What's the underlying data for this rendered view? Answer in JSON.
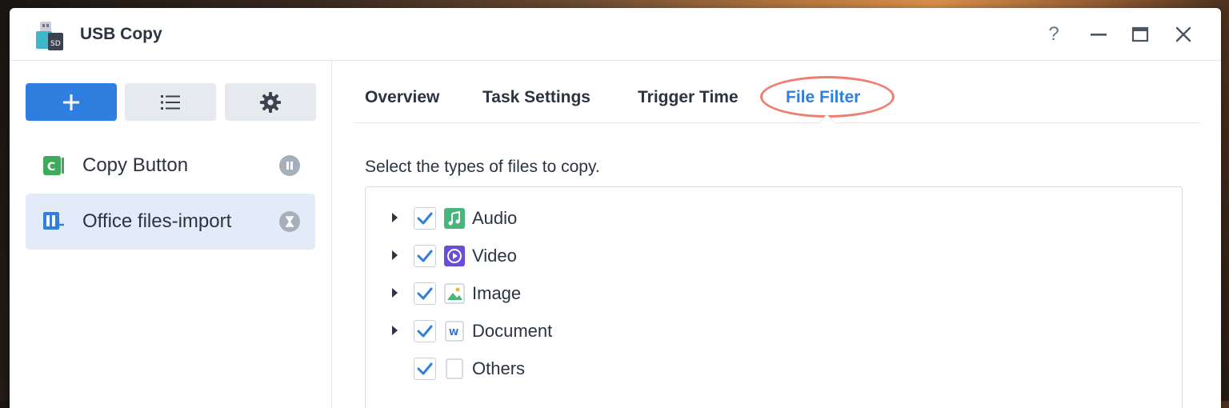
{
  "window": {
    "title": "USB Copy",
    "app_icon": "usb-sd-icon"
  },
  "title_controls": {
    "help": "?",
    "icons": [
      "help-icon",
      "minimize-icon",
      "maximize-icon",
      "close-icon"
    ]
  },
  "toolbar": {
    "icons": [
      "plus-icon",
      "list-icon",
      "gear-icon"
    ],
    "accent": "#2f7fe0"
  },
  "tasks": [
    {
      "label": "Copy Button",
      "icon": "copy-button-icon",
      "status_icon": "pause-icon",
      "selected": false
    },
    {
      "label": "Office files-import",
      "icon": "import-icon",
      "status_icon": "hourglass-icon",
      "selected": true
    }
  ],
  "tabs": [
    {
      "label": "Overview",
      "active": false
    },
    {
      "label": "Task Settings",
      "active": false
    },
    {
      "label": "Trigger Time",
      "active": false
    },
    {
      "label": "File Filter",
      "active": true
    }
  ],
  "file_filter": {
    "description": "Select the types of files to copy.",
    "types": [
      {
        "label": "Audio",
        "checked": true,
        "expandable": true,
        "icon": "audio-icon"
      },
      {
        "label": "Video",
        "checked": true,
        "expandable": true,
        "icon": "video-icon"
      },
      {
        "label": "Image",
        "checked": true,
        "expandable": true,
        "icon": "image-icon"
      },
      {
        "label": "Document",
        "checked": true,
        "expandable": true,
        "icon": "document-icon"
      },
      {
        "label": "Others",
        "checked": true,
        "expandable": false,
        "icon": "file-icon"
      }
    ]
  },
  "colors": {
    "accent": "#2f7fe0",
    "highlight": "#ef7e72",
    "selected_bg": "#e3ebf8"
  }
}
